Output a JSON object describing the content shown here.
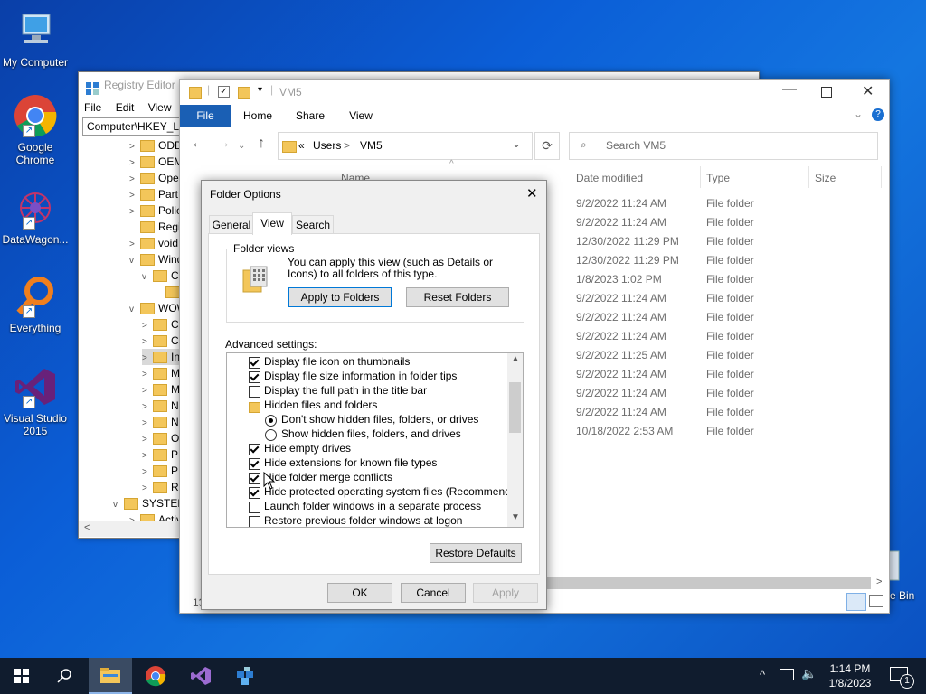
{
  "desktop": {
    "icons": [
      "My Computer",
      "Google Chrome",
      "DataWagon...",
      "Everything",
      "Visual Studio 2015"
    ],
    "recycle_label": "e Bin"
  },
  "registry": {
    "title": "Registry Editor",
    "menu": [
      "File",
      "Edit",
      "View"
    ],
    "address": "Computer\\HKEY_LO",
    "tree": [
      "ODB",
      "OEM",
      "Ope",
      "Part",
      "Polic",
      "Regi",
      "void",
      "Wind",
      "C",
      "",
      "WOW",
      "C",
      "C",
      "In",
      "M",
      "M",
      "N",
      "N",
      "O",
      "P",
      "P",
      "R",
      "SYSTEM",
      "Activ"
    ]
  },
  "explorer": {
    "title": "VM5",
    "tabs": [
      "File",
      "Home",
      "Share",
      "View"
    ],
    "breadcrumb_prefix": "«",
    "breadcrumb": [
      "Users",
      "VM5"
    ],
    "search_placeholder": "Search VM5",
    "columns": {
      "name": "Name",
      "date": "Date modified",
      "type": "Type",
      "size": "Size"
    },
    "rows": [
      {
        "date": "9/2/2022 11:24 AM",
        "type": "File folder"
      },
      {
        "date": "9/2/2022 11:24 AM",
        "type": "File folder"
      },
      {
        "date": "12/30/2022 11:29 PM",
        "type": "File folder"
      },
      {
        "date": "12/30/2022 11:29 PM",
        "type": "File folder"
      },
      {
        "date": "1/8/2023 1:02 PM",
        "type": "File folder"
      },
      {
        "date": "9/2/2022 11:24 AM",
        "type": "File folder"
      },
      {
        "date": "9/2/2022 11:24 AM",
        "type": "File folder"
      },
      {
        "date": "9/2/2022 11:24 AM",
        "type": "File folder"
      },
      {
        "date": "9/2/2022 11:25 AM",
        "type": "File folder"
      },
      {
        "date": "9/2/2022 11:24 AM",
        "type": "File folder"
      },
      {
        "date": "9/2/2022 11:24 AM",
        "type": "File folder"
      },
      {
        "date": "9/2/2022 11:24 AM",
        "type": "File folder"
      },
      {
        "date": "10/18/2022 2:53 AM",
        "type": "File folder"
      }
    ],
    "status_items": "13"
  },
  "dialog": {
    "title": "Folder Options",
    "tabs": [
      "General",
      "View",
      "Search"
    ],
    "folder_views_label": "Folder views",
    "folder_views_text": "You can apply this view (such as Details or Icons) to all folders of this type.",
    "apply_to_folders": "Apply to Folders",
    "reset_folders": "Reset Folders",
    "advanced_label": "Advanced settings:",
    "settings": [
      {
        "kind": "checkbox",
        "checked": true,
        "label": "Display file icon on thumbnails"
      },
      {
        "kind": "checkbox",
        "checked": true,
        "label": "Display file size information in folder tips"
      },
      {
        "kind": "checkbox",
        "checked": false,
        "label": "Display the full path in the title bar"
      },
      {
        "kind": "folder",
        "checked": false,
        "label": "Hidden files and folders"
      },
      {
        "kind": "radio",
        "checked": true,
        "label": "Don't show hidden files, folders, or drives"
      },
      {
        "kind": "radio",
        "checked": false,
        "label": "Show hidden files, folders, and drives"
      },
      {
        "kind": "checkbox",
        "checked": true,
        "label": "Hide empty drives"
      },
      {
        "kind": "checkbox",
        "checked": true,
        "label": "Hide extensions for known file types"
      },
      {
        "kind": "checkbox",
        "checked": true,
        "label": "Hide folder merge conflicts"
      },
      {
        "kind": "checkbox",
        "checked": true,
        "label": "Hide protected operating system files (Recommended)"
      },
      {
        "kind": "checkbox",
        "checked": false,
        "label": "Launch folder windows in a separate process"
      },
      {
        "kind": "checkbox",
        "checked": false,
        "label": "Restore previous folder windows at logon"
      }
    ],
    "restore_defaults": "Restore Defaults",
    "ok": "OK",
    "cancel": "Cancel",
    "apply": "Apply"
  },
  "taskbar": {
    "time": "1:14 PM",
    "date": "1/8/2023",
    "notification_count": "1"
  },
  "colors": {
    "accent": "#1a5fb4",
    "taskbar": "#101c2e",
    "folder": "#f3c65a"
  }
}
